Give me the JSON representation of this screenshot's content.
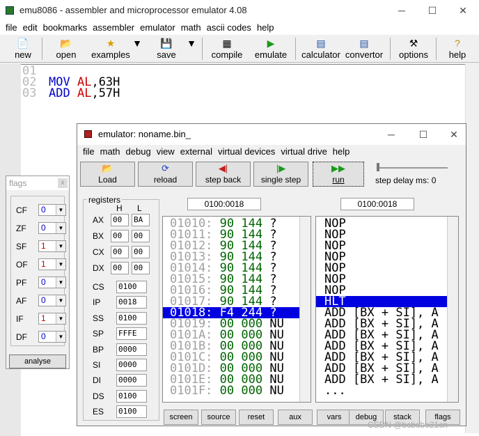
{
  "main": {
    "title": "emu8086 - assembler and microprocessor emulator 4.08",
    "menu": [
      "file",
      "edit",
      "bookmarks",
      "assembler",
      "emulator",
      "math",
      "ascii codes",
      "help"
    ],
    "toolbar": [
      {
        "label": "new",
        "icon": "new-file-icon"
      },
      {
        "label": "open",
        "icon": "open-folder-icon"
      },
      {
        "label": "examples",
        "icon": "star-icon"
      },
      {
        "label": "save",
        "icon": "save-disk-icon"
      },
      {
        "label": "compile",
        "icon": "compile-icon"
      },
      {
        "label": "emulate",
        "icon": "play-icon"
      },
      {
        "label": "calculator",
        "icon": "calculator-icon"
      },
      {
        "label": "convertor",
        "icon": "convertor-icon"
      },
      {
        "label": "options",
        "icon": "tools-icon"
      },
      {
        "label": "help",
        "icon": "help-icon"
      }
    ]
  },
  "editor": {
    "line_numbers": [
      "01",
      "02",
      "03"
    ],
    "lines": [
      {
        "op": "",
        "reg": "",
        "val": ""
      },
      {
        "op": "MOV",
        "reg": "AL",
        "val": ",63H"
      },
      {
        "op": "ADD",
        "reg": "AL",
        "val": ",57H"
      }
    ]
  },
  "flags": {
    "title": "flags",
    "close": "x",
    "items": [
      {
        "name": "CF",
        "value": "0"
      },
      {
        "name": "ZF",
        "value": "0"
      },
      {
        "name": "SF",
        "value": "1"
      },
      {
        "name": "OF",
        "value": "1"
      },
      {
        "name": "PF",
        "value": "0"
      },
      {
        "name": "AF",
        "value": "0"
      },
      {
        "name": "IF",
        "value": "1"
      },
      {
        "name": "DF",
        "value": "0"
      }
    ],
    "analyse": "analyse"
  },
  "emu": {
    "title": "emulator: noname.bin_",
    "menu": [
      "file",
      "math",
      "debug",
      "view",
      "external",
      "virtual devices",
      "virtual drive",
      "help"
    ],
    "buttons": [
      {
        "label": "Load",
        "icon": "load-folder-icon"
      },
      {
        "label": "reload",
        "icon": "reload-icon"
      },
      {
        "label": "step back",
        "icon": "step-back-icon"
      },
      {
        "label": "single step",
        "icon": "single-step-icon"
      },
      {
        "label": "run",
        "icon": "run-icon"
      }
    ],
    "step_delay": "step delay ms: 0",
    "registers_title": "registers",
    "hl": {
      "h": "H",
      "l": "L"
    },
    "byte_regs": [
      {
        "name": "AX",
        "h": "00",
        "l": "BA"
      },
      {
        "name": "BX",
        "h": "00",
        "l": "00"
      },
      {
        "name": "CX",
        "h": "00",
        "l": "00"
      },
      {
        "name": "DX",
        "h": "00",
        "l": "00"
      }
    ],
    "word_regs": [
      {
        "name": "CS",
        "v": "0100"
      },
      {
        "name": "IP",
        "v": "0018"
      },
      {
        "name": "SS",
        "v": "0100"
      },
      {
        "name": "SP",
        "v": "FFFE"
      },
      {
        "name": "BP",
        "v": "0000"
      },
      {
        "name": "SI",
        "v": "0000"
      },
      {
        "name": "DI",
        "v": "0000"
      },
      {
        "name": "DS",
        "v": "0100"
      },
      {
        "name": "ES",
        "v": "0100"
      }
    ],
    "addr_left": "0100:0018",
    "addr_right": "0100:0018",
    "mem": [
      {
        "a": "01010:",
        "h": "90",
        "d": "144",
        "c": "?"
      },
      {
        "a": "01011:",
        "h": "90",
        "d": "144",
        "c": "?"
      },
      {
        "a": "01012:",
        "h": "90",
        "d": "144",
        "c": "?"
      },
      {
        "a": "01013:",
        "h": "90",
        "d": "144",
        "c": "?"
      },
      {
        "a": "01014:",
        "h": "90",
        "d": "144",
        "c": "?"
      },
      {
        "a": "01015:",
        "h": "90",
        "d": "144",
        "c": "?"
      },
      {
        "a": "01016:",
        "h": "90",
        "d": "144",
        "c": "?"
      },
      {
        "a": "01017:",
        "h": "90",
        "d": "144",
        "c": "?"
      },
      {
        "a": "01018:",
        "h": "F4",
        "d": "244",
        "c": "?"
      },
      {
        "a": "01019:",
        "h": "00",
        "d": "000",
        "c": "NU"
      },
      {
        "a": "0101A:",
        "h": "00",
        "d": "000",
        "c": "NU"
      },
      {
        "a": "0101B:",
        "h": "00",
        "d": "000",
        "c": "NU"
      },
      {
        "a": "0101C:",
        "h": "00",
        "d": "000",
        "c": "NU"
      },
      {
        "a": "0101D:",
        "h": "00",
        "d": "000",
        "c": "NU"
      },
      {
        "a": "0101E:",
        "h": "00",
        "d": "000",
        "c": "NU"
      },
      {
        "a": "0101F:",
        "h": "00",
        "d": "000",
        "c": "NU"
      }
    ],
    "asm": [
      "NOP",
      "NOP",
      "NOP",
      "NOP",
      "NOP",
      "NOP",
      "NOP",
      "HLT",
      "ADD [BX + SI], A",
      "ADD [BX + SI], A",
      "ADD [BX + SI], A",
      "ADD [BX + SI], A",
      "ADD [BX + SI], A",
      "ADD [BX + SI], A",
      "ADD [BX + SI], A",
      "..."
    ],
    "bottom": [
      "screen",
      "source",
      "reset",
      "aux",
      "vars",
      "debug",
      "stack",
      "flags"
    ]
  },
  "watermark": "CSDN @bcbobo21cn"
}
